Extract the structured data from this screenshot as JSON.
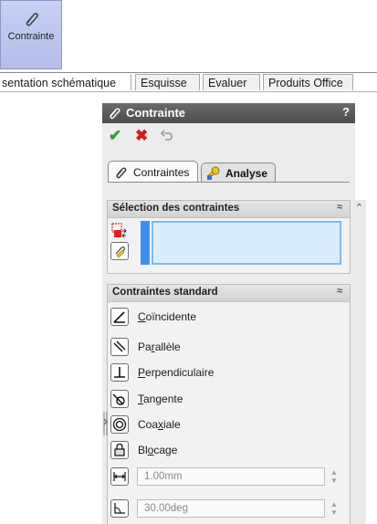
{
  "ribbon": {
    "big_button_label": "Contrainte"
  },
  "tabstrip": {
    "tabs": [
      "sentation schématique",
      "Esquisse",
      "Evaluer",
      "Produits Office"
    ]
  },
  "panel": {
    "title": "Contrainte",
    "help": "?",
    "tabs": [
      {
        "label": "Contraintes"
      },
      {
        "label": "Analyse"
      }
    ],
    "selection_group": {
      "title": "Sélection des contraintes",
      "collapse_glyph": "≈"
    },
    "standard_group": {
      "title": "Contraintes standard",
      "collapse_glyph": "≈",
      "items": [
        {
          "pre": "",
          "acc": "C",
          "post": "oïncidente"
        },
        {
          "pre": "Pa",
          "acc": "r",
          "post": "allèle"
        },
        {
          "pre": "",
          "acc": "P",
          "post": "erpendiculaire"
        },
        {
          "pre": "",
          "acc": "T",
          "post": "angente"
        },
        {
          "pre": "Coa",
          "acc": "x",
          "post": "iale"
        },
        {
          "pre": "Bl",
          "acc": "o",
          "post": "cage"
        }
      ],
      "distance_value": "1.00mm",
      "angle_value": "30.00deg"
    }
  },
  "colors": {
    "ribbon_button": "#bec6f0",
    "titlebar": "#555555",
    "selection_field": "#d9eefc",
    "selection_border": "#7fbce9",
    "check": "#2fa12f",
    "cross": "#d11a1a"
  }
}
